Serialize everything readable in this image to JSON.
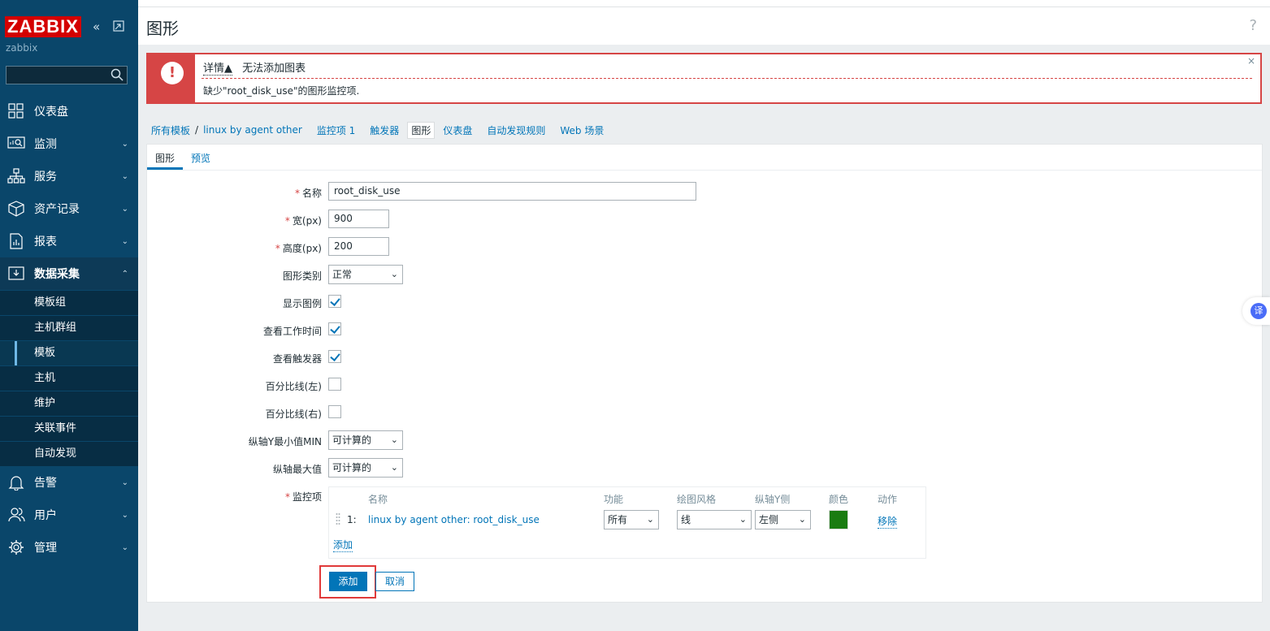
{
  "sidebar": {
    "logo": "ZABBIX",
    "server": "zabbix",
    "search_value": "",
    "menu": [
      {
        "label": "仪表盘",
        "icon": "dashboard-icon"
      },
      {
        "label": "监测",
        "icon": "monitoring-icon"
      },
      {
        "label": "服务",
        "icon": "services-icon"
      },
      {
        "label": "资产记录",
        "icon": "inventory-icon"
      },
      {
        "label": "报表",
        "icon": "reports-icon"
      },
      {
        "label": "数据采集",
        "icon": "data-collection-icon"
      },
      {
        "label": "告警",
        "icon": "alerts-icon"
      },
      {
        "label": "用户",
        "icon": "users-icon"
      },
      {
        "label": "管理",
        "icon": "administration-icon"
      }
    ],
    "submenu": [
      "模板组",
      "主机群组",
      "模板",
      "主机",
      "维护",
      "关联事件",
      "自动发现"
    ],
    "active_submenu": "模板"
  },
  "header": {
    "title": "图形",
    "help": "?"
  },
  "error": {
    "details": "详情▲",
    "title": "无法添加图表",
    "message": "缺少\"root_disk_use\"的图形监控项.",
    "close": "×"
  },
  "breadcrumb": {
    "all_templates": "所有模板",
    "separator": "/",
    "template": "linux by agent other",
    "items": "监控项 1",
    "triggers": "触发器",
    "graphs": "图形",
    "dashboards": "仪表盘",
    "discovery": "自动发现规则",
    "web": "Web 场景"
  },
  "tabs": [
    "图形",
    "预览"
  ],
  "form": {
    "name_label": "名称",
    "name_value": "root_disk_use",
    "width_label": "宽(px)",
    "width_value": "900",
    "height_label": "高度(px)",
    "height_value": "200",
    "type_label": "图形类别",
    "type_value": "正常",
    "legend_label": "显示图例",
    "worktime_label": "查看工作时间",
    "triggers_label": "查看触发器",
    "pct_left_label": "百分比线(左)",
    "pct_right_label": "百分比线(右)",
    "ymin_label": "纵轴Y最小值MIN",
    "ymin_value": "可计算的",
    "ymax_label": "纵轴最大值",
    "ymax_value": "可计算的",
    "items_label": "监控项",
    "items_headers": {
      "name": "名称",
      "function": "功能",
      "draw": "绘图风格",
      "yaxis": "纵轴Y侧",
      "color": "颜色",
      "action": "动作"
    },
    "item_row": {
      "index": "1:",
      "name": "linux by agent other: root_disk_use",
      "function": "所有",
      "draw": "线",
      "yaxis": "左侧",
      "color": "#1a7c11",
      "action": "移除"
    },
    "items_add": "添加",
    "checkboxes": {
      "legend": true,
      "worktime": true,
      "triggers": true,
      "pct_left": false,
      "pct_right": false
    }
  },
  "buttons": {
    "add": "添加",
    "cancel": "取消"
  },
  "translate_badge": "译"
}
